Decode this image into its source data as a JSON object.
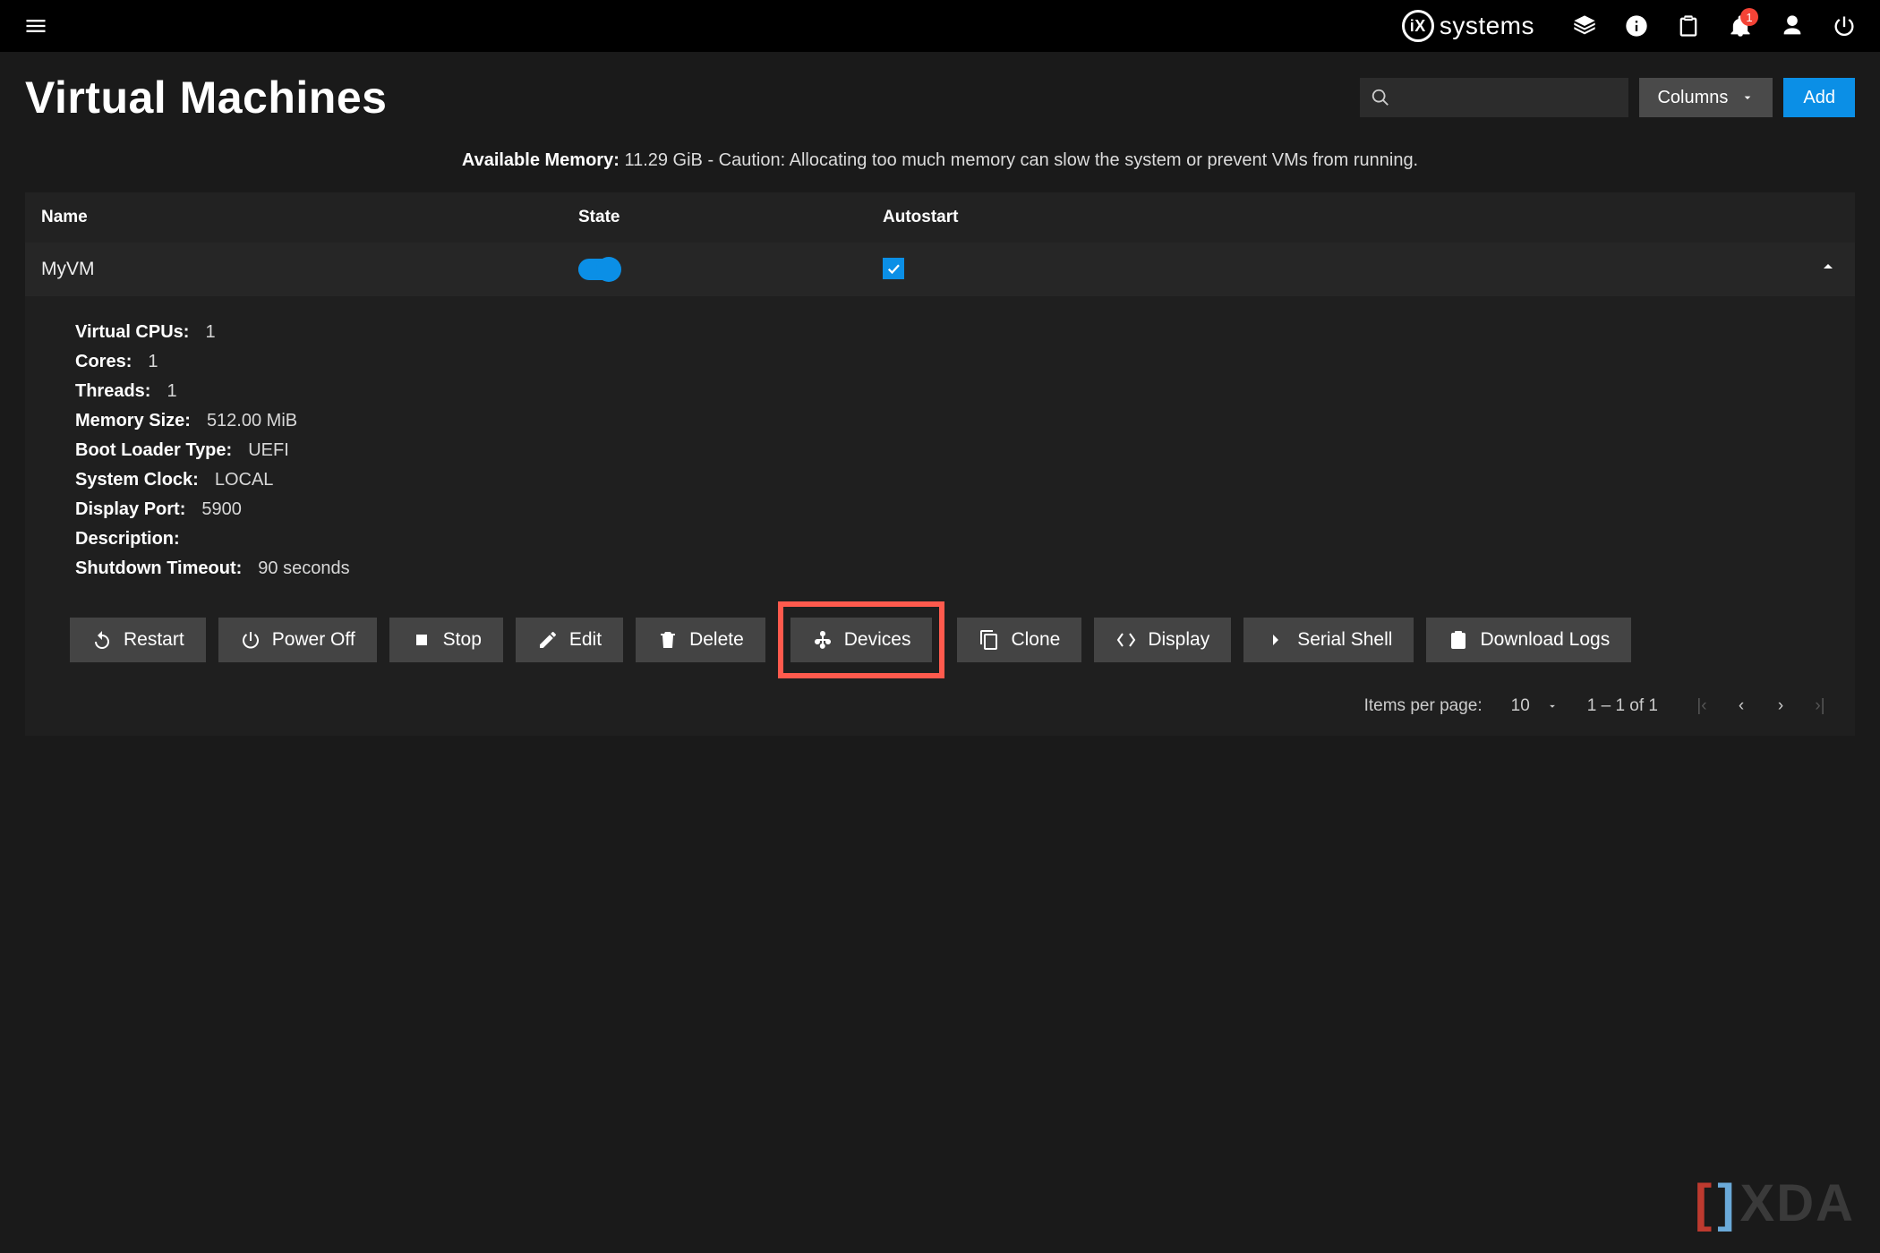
{
  "topbar": {
    "brand_text": "systems",
    "brand_badge": "iX",
    "notification_count": "1"
  },
  "page_title": "Virtual Machines",
  "search_placeholder": "",
  "columns_btn": "Columns",
  "add_btn": "Add",
  "memory_caption_label": "Available Memory:",
  "memory_caption_text": "11.29 GiB - Caution: Allocating too much memory can slow the system or prevent VMs from running.",
  "table": {
    "headers": {
      "name": "Name",
      "state": "State",
      "autostart": "Autostart"
    },
    "row": {
      "name": "MyVM",
      "state_on": true,
      "autostart_checked": true
    }
  },
  "details": {
    "virtual_cpus": {
      "label": "Virtual CPUs:",
      "value": "1"
    },
    "cores": {
      "label": "Cores:",
      "value": "1"
    },
    "threads": {
      "label": "Threads:",
      "value": "1"
    },
    "memory_size": {
      "label": "Memory Size:",
      "value": "512.00 MiB"
    },
    "boot_loader_type": {
      "label": "Boot Loader Type:",
      "value": "UEFI"
    },
    "system_clock": {
      "label": "System Clock:",
      "value": "LOCAL"
    },
    "display_port": {
      "label": "Display Port:",
      "value": "5900"
    },
    "description": {
      "label": "Description:",
      "value": ""
    },
    "shutdown_timeout": {
      "label": "Shutdown Timeout:",
      "value": "90 seconds"
    }
  },
  "actions": {
    "restart": "Restart",
    "power_off": "Power Off",
    "stop": "Stop",
    "edit": "Edit",
    "delete": "Delete",
    "devices": "Devices",
    "clone": "Clone",
    "display": "Display",
    "serial_shell": "Serial Shell",
    "download_logs": "Download Logs"
  },
  "paginator": {
    "items_per_page_label": "Items per page:",
    "items_per_page_value": "10",
    "range": "1 – 1 of 1"
  },
  "watermark": "XDA"
}
